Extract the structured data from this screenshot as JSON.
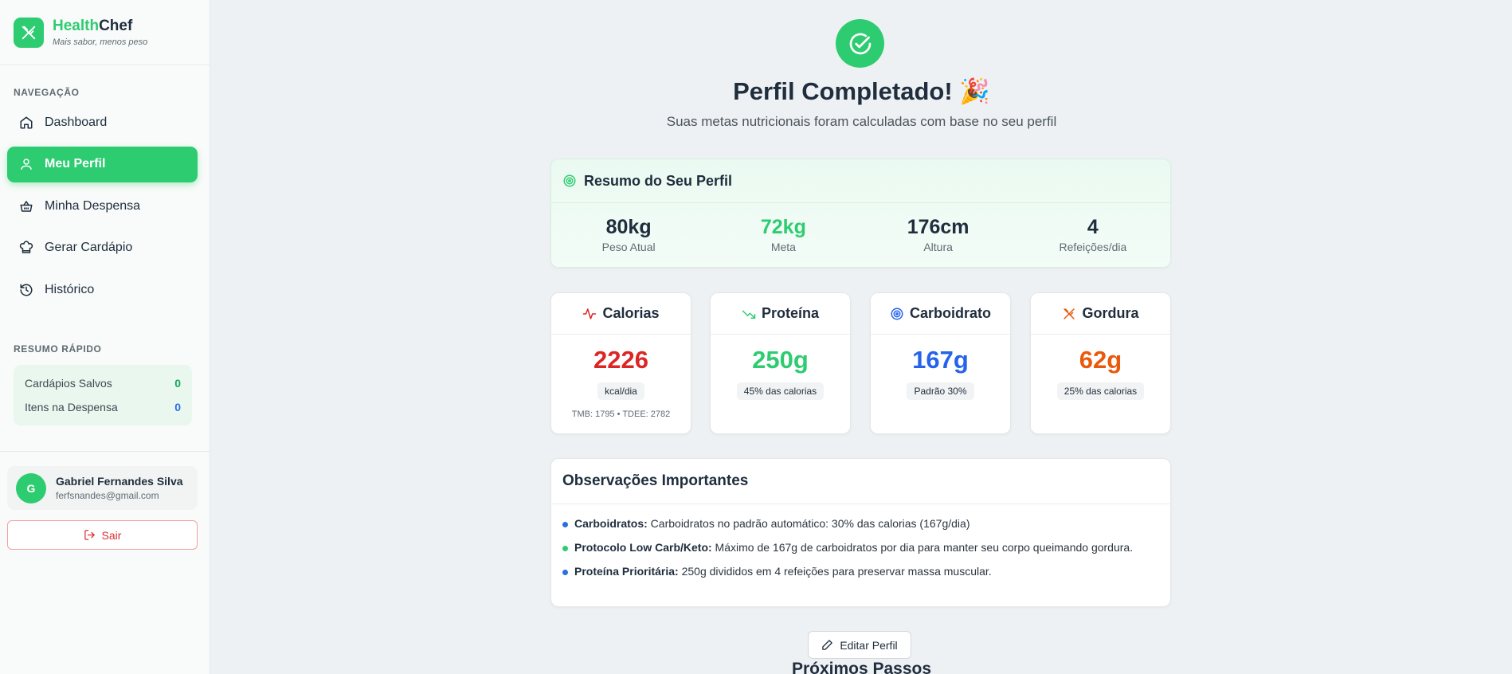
{
  "brand": {
    "name_part1": "Health",
    "name_part2": "Chef",
    "tagline": "Mais sabor, menos peso"
  },
  "sidebar": {
    "nav_label": "NAVEGAÇÃO",
    "items": [
      {
        "label": "Dashboard",
        "icon": "home-icon"
      },
      {
        "label": "Meu Perfil",
        "icon": "user-icon",
        "active": true
      },
      {
        "label": "Minha Despensa",
        "icon": "basket-icon"
      },
      {
        "label": "Gerar Cardápio",
        "icon": "chef-hat-icon"
      },
      {
        "label": "Histórico",
        "icon": "history-icon"
      }
    ],
    "quick_label": "RESUMO RÁPIDO",
    "quick": [
      {
        "label": "Cardápios Salvos",
        "value": "0"
      },
      {
        "label": "Itens na Despensa",
        "value": "0"
      }
    ],
    "user": {
      "initial": "G",
      "name": "Gabriel Fernandes Silva",
      "email": "ferfsnandes@gmail.com"
    },
    "logout_label": "Sair"
  },
  "hero": {
    "title": "Perfil Completado! 🎉",
    "subtitle": "Suas metas nutricionais foram calculadas com base no seu perfil"
  },
  "summary": {
    "title": "Resumo do Seu Perfil",
    "stats": [
      {
        "value": "80kg",
        "label": "Peso Atual"
      },
      {
        "value": "72kg",
        "label": "Meta"
      },
      {
        "value": "176cm",
        "label": "Altura"
      },
      {
        "value": "4",
        "label": "Refeições/dia"
      }
    ]
  },
  "macros": [
    {
      "title": "Calorias",
      "value": "2226",
      "badge": "kcal/dia",
      "note": "TMB: 1795 • TDEE: 2782",
      "color": "#dc2626",
      "icon": "activity-icon"
    },
    {
      "title": "Proteína",
      "value": "250g",
      "badge": "45% das calorias",
      "color": "#2ecc71",
      "icon": "trending-down-icon"
    },
    {
      "title": "Carboidrato",
      "value": "167g",
      "badge": "Padrão 30%",
      "color": "#2563eb",
      "icon": "target-icon"
    },
    {
      "title": "Gordura",
      "value": "62g",
      "badge": "25% das calorias",
      "color": "#ea580c",
      "icon": "utensils-icon"
    }
  ],
  "observations": {
    "title": "Observações Importantes",
    "items": [
      {
        "bold": "Carboidratos:",
        "text": " Carboidratos no padrão automático: 30% das calorias (167g/dia)"
      },
      {
        "bold": "Protocolo Low Carb/Keto:",
        "text": " Máximo de 167g de carboidratos por dia para manter seu corpo queimando gordura."
      },
      {
        "bold": "Proteína Prioritária:",
        "text": " 250g divididos em 4 refeições para preservar massa muscular."
      }
    ]
  },
  "edit_label": "Editar Perfil",
  "next_title": "Próximos Passos"
}
